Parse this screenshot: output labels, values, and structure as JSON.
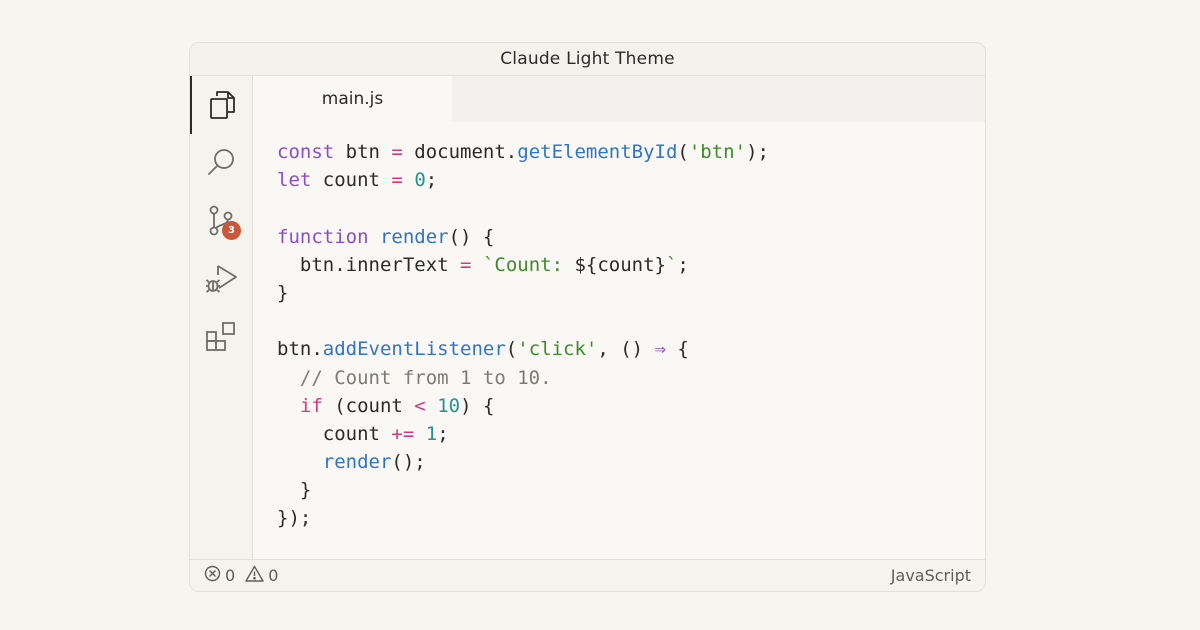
{
  "window": {
    "title": "Claude Light Theme"
  },
  "activity_bar": {
    "items": [
      {
        "name": "explorer",
        "icon": "files-icon",
        "active": true
      },
      {
        "name": "search",
        "icon": "search-icon",
        "active": false
      },
      {
        "name": "source-control",
        "icon": "source-control-icon",
        "badge": "3",
        "active": false
      },
      {
        "name": "run-debug",
        "icon": "run-debug-icon",
        "active": false
      },
      {
        "name": "extensions",
        "icon": "extensions-icon",
        "active": false
      }
    ]
  },
  "tabs": [
    {
      "label": "main.js",
      "active": true
    }
  ],
  "code": {
    "language": "javascript",
    "lines": [
      [
        {
          "t": "const",
          "c": "kw"
        },
        {
          "t": " btn "
        },
        {
          "t": "=",
          "c": "op"
        },
        {
          "t": " document."
        },
        {
          "t": "getElementById",
          "c": "fn"
        },
        {
          "t": "("
        },
        {
          "t": "'btn'",
          "c": "str"
        },
        {
          "t": ");"
        }
      ],
      [
        {
          "t": "let",
          "c": "kw"
        },
        {
          "t": " count "
        },
        {
          "t": "=",
          "c": "op"
        },
        {
          "t": " "
        },
        {
          "t": "0",
          "c": "num"
        },
        {
          "t": ";"
        }
      ],
      [],
      [
        {
          "t": "function",
          "c": "kw"
        },
        {
          "t": " "
        },
        {
          "t": "render",
          "c": "fn"
        },
        {
          "t": "() {"
        }
      ],
      [
        {
          "t": "  btn.innerText "
        },
        {
          "t": "=",
          "c": "op"
        },
        {
          "t": " "
        },
        {
          "t": "`Count: ",
          "c": "str"
        },
        {
          "t": "${count}"
        },
        {
          "t": "`",
          "c": "str"
        },
        {
          "t": ";"
        }
      ],
      [
        {
          "t": "}"
        }
      ],
      [],
      [
        {
          "t": "btn."
        },
        {
          "t": "addEventListener",
          "c": "fn"
        },
        {
          "t": "("
        },
        {
          "t": "'click'",
          "c": "str"
        },
        {
          "t": ", () "
        },
        {
          "t": "⇒",
          "c": "arrow"
        },
        {
          "t": " {"
        }
      ],
      [
        {
          "t": "  "
        },
        {
          "t": "// Count from 1 to 10.",
          "c": "cm"
        }
      ],
      [
        {
          "t": "  "
        },
        {
          "t": "if",
          "c": "ctl"
        },
        {
          "t": " (count "
        },
        {
          "t": "<",
          "c": "op"
        },
        {
          "t": " "
        },
        {
          "t": "10",
          "c": "num"
        },
        {
          "t": ") {"
        }
      ],
      [
        {
          "t": "    count "
        },
        {
          "t": "+=",
          "c": "op"
        },
        {
          "t": " "
        },
        {
          "t": "1",
          "c": "num"
        },
        {
          "t": ";"
        }
      ],
      [
        {
          "t": "    "
        },
        {
          "t": "render",
          "c": "fn"
        },
        {
          "t": "();"
        }
      ],
      [
        {
          "t": "  }"
        }
      ],
      [
        {
          "t": "});"
        }
      ]
    ]
  },
  "status_bar": {
    "errors": {
      "icon": "error-circle-icon",
      "count": "0"
    },
    "warnings": {
      "icon": "warning-triangle-icon",
      "count": "0"
    },
    "language": "JavaScript"
  },
  "colors": {
    "keyword": "#8a4fc8",
    "function": "#2f74c8",
    "string": "#3f8a2e",
    "number": "#23958e",
    "operator": "#d43a7a",
    "comment": "#7c7b76",
    "badge": "#c9573b"
  }
}
